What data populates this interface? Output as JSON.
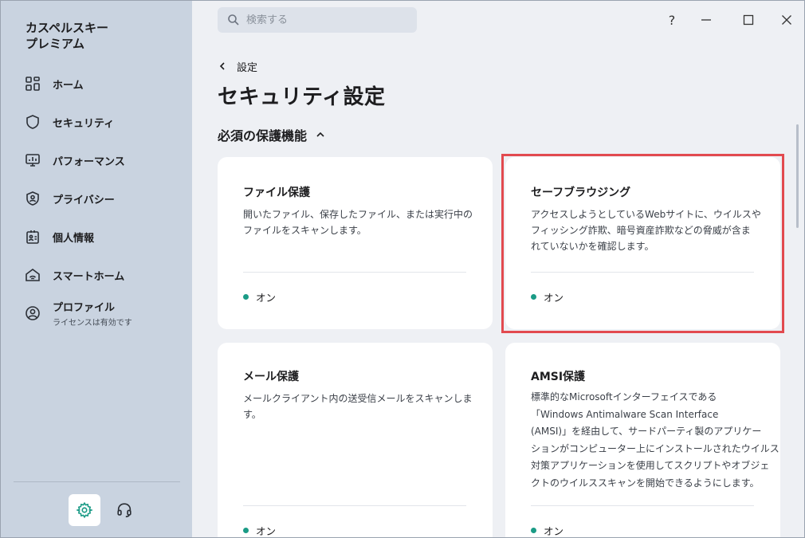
{
  "app": {
    "title_line1": "カスペルスキー",
    "title_line2": "プレミアム"
  },
  "sidebar": {
    "items": [
      {
        "label": "ホーム",
        "icon": "home-grid-icon"
      },
      {
        "label": "セキュリティ",
        "icon": "shield-icon"
      },
      {
        "label": "パフォーマンス",
        "icon": "monitor-icon"
      },
      {
        "label": "プライバシー",
        "icon": "privacy-shield-icon"
      },
      {
        "label": "個人情報",
        "icon": "id-card-icon"
      },
      {
        "label": "スマートホーム",
        "icon": "smart-home-icon"
      },
      {
        "label": "プロファイル",
        "sub": "ライセンスは有効です",
        "icon": "user-circle-icon"
      }
    ],
    "bottom": {
      "settings_icon": "gear-icon",
      "support_icon": "headset-icon"
    }
  },
  "topbar": {
    "search_placeholder": "検索する",
    "help_label": "?"
  },
  "main": {
    "back_label": "設定",
    "page_title": "セキュリティ設定",
    "section_title": "必須の保護機能",
    "cards": [
      {
        "title": "ファイル保護",
        "desc_lines": [
          "開いたファイル、保存したファイル、または実行中の",
          "ファイルをスキャンします。"
        ],
        "status": "オン"
      },
      {
        "title": "セーフブラウジング",
        "desc_lines": [
          "アクセスしようとしているWebサイトに、ウイルスや",
          "フィッシング詐欺、暗号資産詐欺などの脅威が含ま",
          "れていないかを確認します。"
        ],
        "status": "オン"
      },
      {
        "title": "メール保護",
        "desc_lines": [
          "メールクライアント内の送受信メールをスキャンしま",
          "す。"
        ],
        "status": "オン"
      },
      {
        "title": "AMSI保護",
        "desc_lines": [
          "標準的なMicrosoftインターフェイスである",
          "「Windows Antimalware Scan Interface",
          "(AMSI)」を経由して、サードパーティ製のアプリケー",
          "ションがコンピューター上にインストールされたウイルス",
          "対策アプリケーションを使用してスクリプトやオブジェ",
          "クトのウイルススキャンを開始できるようにします。"
        ],
        "status": "オン"
      }
    ]
  },
  "colors": {
    "sidebar_bg": "#c9d3e0",
    "status_on": "#1b9b86",
    "highlight": "#e24a4f",
    "accent": "#1b9b86"
  }
}
